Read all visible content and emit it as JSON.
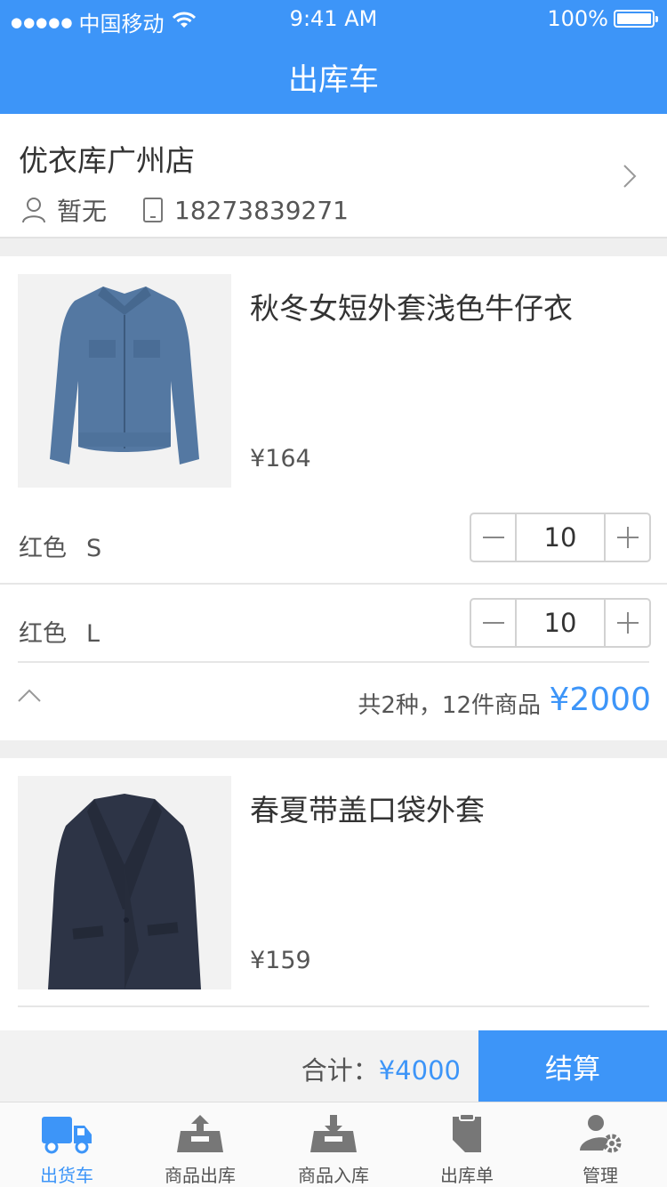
{
  "status_bar": {
    "carrier": "中国移动",
    "time": "9:41 AM",
    "battery": "100%"
  },
  "nav": {
    "title": "出库车"
  },
  "store": {
    "name": "优衣库广州店",
    "contact": "暂无",
    "phone": "18273839271"
  },
  "products": [
    {
      "title": "秋冬女短外套浅色牛仔衣",
      "price": "¥164",
      "skus": [
        {
          "color": "红色",
          "size": "S",
          "qty": "10"
        },
        {
          "color": "红色",
          "size": "L",
          "qty": "10"
        }
      ],
      "summary": "共2种，12件商品",
      "total": "¥2000"
    },
    {
      "title": "春夏带盖口袋外套",
      "price": "¥159"
    }
  ],
  "checkout": {
    "label": "合计：",
    "amount": "¥4000",
    "button": "结算"
  },
  "tabs": [
    {
      "label": "出货车",
      "icon": "truck-icon",
      "active": true
    },
    {
      "label": "商品出库",
      "icon": "box-out-icon",
      "active": false
    },
    {
      "label": "商品入库",
      "icon": "box-in-icon",
      "active": false
    },
    {
      "label": "出库单",
      "icon": "document-icon",
      "active": false
    },
    {
      "label": "管理",
      "icon": "user-settings-icon",
      "active": false
    }
  ],
  "colors": {
    "accent": "#3d95f8",
    "background": "#efefef"
  }
}
